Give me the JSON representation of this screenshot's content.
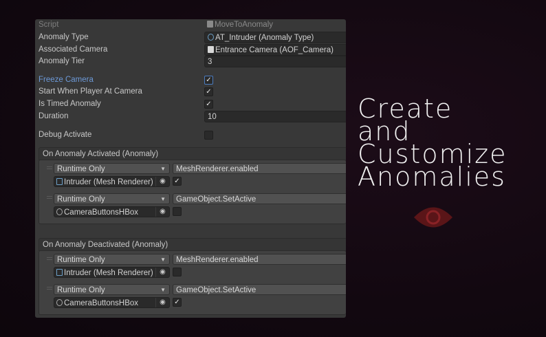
{
  "inspector": {
    "script": {
      "label": "Script",
      "value": "MoveToAnomaly"
    },
    "anomaly_type": {
      "label": "Anomaly Type",
      "value": "AT_Intruder (Anomaly Type)"
    },
    "associated_camera": {
      "label": "Associated Camera",
      "value": "Entrance Camera (AOF_Camera)"
    },
    "anomaly_tier": {
      "label": "Anomaly Tier",
      "value": "3"
    },
    "freeze_camera": {
      "label": "Freeze Camera",
      "checked": true
    },
    "start_when_player": {
      "label": "Start When Player At Camera",
      "checked": true
    },
    "is_timed": {
      "label": "Is Timed Anomaly",
      "checked": true
    },
    "duration": {
      "label": "Duration",
      "value": "10"
    },
    "debug_activate": {
      "label": "Debug Activate",
      "checked": false
    },
    "check_glyph": "✓",
    "events": [
      {
        "header": "On Anomaly Activated (Anomaly)",
        "listeners": [
          {
            "mode": "Runtime Only",
            "function": "MeshRenderer.enabled",
            "object": "Intruder (Mesh Renderer)",
            "checked": true
          },
          {
            "mode": "Runtime Only",
            "function": "GameObject.SetActive",
            "object": "CameraButtonsHBox",
            "checked": false
          }
        ]
      },
      {
        "header": "On Anomaly Deactivated (Anomaly)",
        "listeners": [
          {
            "mode": "Runtime Only",
            "function": "MeshRenderer.enabled",
            "object": "Intruder (Mesh Renderer)",
            "checked": false
          },
          {
            "mode": "Runtime Only",
            "function": "GameObject.SetActive",
            "object": "CameraButtonsHBox",
            "checked": true
          }
        ]
      }
    ]
  },
  "headline": {
    "line1": "Create",
    "line2": "and",
    "line3": "Customize",
    "line4": "Anomalies"
  },
  "colors": {
    "accent_blue": "#6d9ad8",
    "eye_red": "#5a1518"
  }
}
